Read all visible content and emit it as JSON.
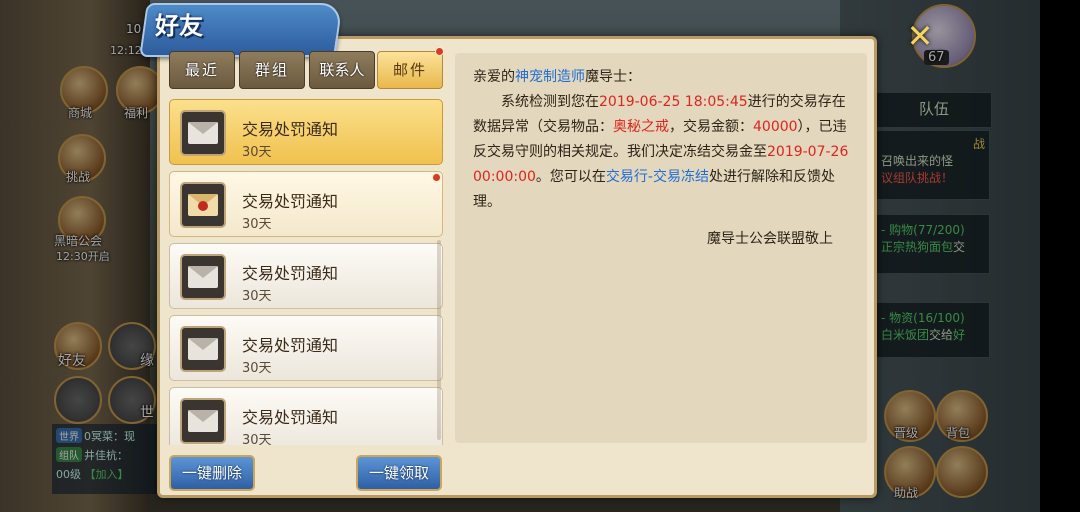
{
  "dialog": {
    "title": "好友",
    "tabs": [
      {
        "label": "最近",
        "active": false
      },
      {
        "label": "群组",
        "active": false
      },
      {
        "label": "联系人",
        "active": false
      },
      {
        "label": "邮件",
        "active": true
      }
    ],
    "mails": [
      {
        "title": "交易处罚通知",
        "days": "30天",
        "state": "selected"
      },
      {
        "title": "交易处罚通知",
        "days": "30天",
        "state": "unread"
      },
      {
        "title": "交易处罚通知",
        "days": "30天",
        "state": "read"
      },
      {
        "title": "交易处罚通知",
        "days": "30天",
        "state": "read"
      },
      {
        "title": "交易处罚通知",
        "days": "30天",
        "state": "read"
      }
    ],
    "message": {
      "greeting_prefix": "亲爱的",
      "greeting_org": "神宠制造师",
      "greeting_suffix": "魔导士：",
      "p1_a": "系统检测到您在",
      "p1_time": "2019-06-25 18:05:45",
      "p1_b": "进行的交易存在数据异常（交易物品：",
      "p1_item": "奥秘之戒",
      "p1_c": "，交易金额：",
      "p1_amount": "40000",
      "p1_d": "），已违反交易守则的相关规定。我们决定冻结交易金至",
      "p1_until": "2019-07-26 00:00:00",
      "p1_e": "。您可以在",
      "p1_link": "交易行-交易冻结",
      "p1_f": "处进行解除和反馈处理。",
      "signature": "魔导士公会联盟敬上"
    },
    "buttons": {
      "delete_all": "一键删除",
      "claim_all": "一键领取"
    }
  },
  "hud": {
    "time_left": "12:12",
    "time_top": "10",
    "shop": "商城",
    "welfare": "福利",
    "challenge": "挑战",
    "guild": "黑暗公会",
    "guild_time": "12:30开启",
    "friends": "好友",
    "fate": "缘",
    "world": "世",
    "level_badge": "67",
    "team_tab": "队伍",
    "quest_battle": "战",
    "quest1_text": "召唤出来的怪",
    "quest1_link": "议组队挑战！",
    "quest2_title": "- 购物(77/200)",
    "quest2_link": "正宗热狗面包",
    "quest2_suffix": "交",
    "quest3_title": "- 物资(16/100)",
    "quest3_link": "白米饭团",
    "quest3_mid": "交给",
    "quest3_end": "好",
    "bag": "背包",
    "equip": "晋级",
    "assist": "助战",
    "chat_tag_world": "世界",
    "chat_world_name": "0冥菜：现",
    "chat_tag_team": "组队",
    "chat_team_name": "井佳杭：",
    "chat_line3": "00级",
    "chat_join": "【加入】"
  },
  "colors": {
    "accent_blue": "#1f6ed8",
    "alert_red": "#e0241e",
    "tab_active": "#f0c14e",
    "dialog_bg": "#efe4cc"
  }
}
